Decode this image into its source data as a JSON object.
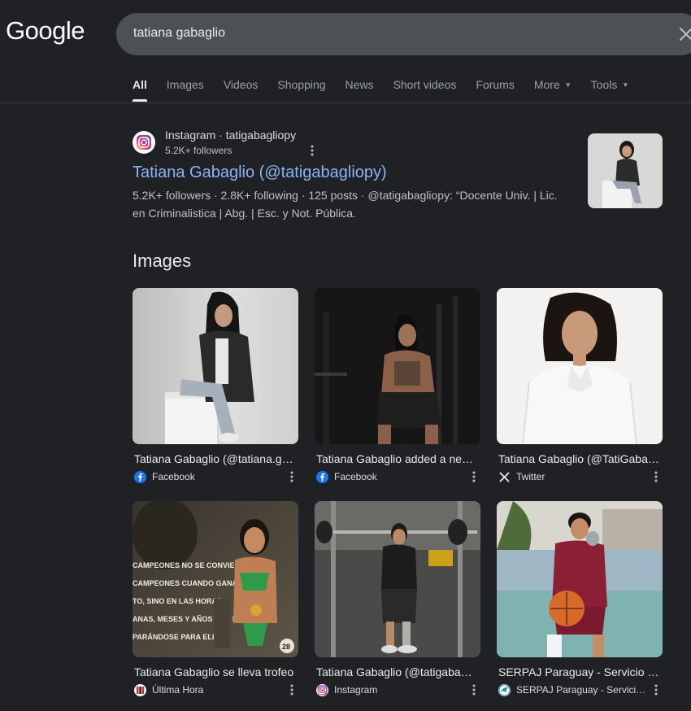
{
  "header": {
    "logo_text": "Google",
    "search_query": "tatiana gabaglio"
  },
  "tabs": [
    {
      "label": "All",
      "active": true
    },
    {
      "label": "Images"
    },
    {
      "label": "Videos"
    },
    {
      "label": "Shopping"
    },
    {
      "label": "News"
    },
    {
      "label": "Short videos"
    },
    {
      "label": "Forums"
    },
    {
      "label": "More",
      "dropdown": true
    },
    {
      "label": "Tools",
      "dropdown": true
    }
  ],
  "result": {
    "source_name": "Instagram · tatigabagliopy",
    "source_sub": "5.2K+ followers",
    "title": "Tatiana Gabaglio (@tatigabagliopy)",
    "snippet": "5.2K+ followers · 2.8K+ following · 125 posts · @tatigabagliopy: “Docente Univ. | Lic. en Criminalistica | Abg. | Esc. y Not. Pública."
  },
  "images_section": {
    "heading": "Images",
    "cards": [
      {
        "caption": "Tatiana Gabaglio (@tatiana.gabaglio)",
        "source": "Facebook",
        "source_icon": "facebook-icon"
      },
      {
        "caption": "Tatiana Gabaglio added a new photo",
        "source": "Facebook",
        "source_icon": "facebook-icon"
      },
      {
        "caption": "Tatiana Gabaglio (@TatiGabaglio)",
        "source": "Twitter",
        "source_icon": "x-icon"
      },
      {
        "caption": "Tatiana Gabaglio se lleva trofeo",
        "source": "Última Hora",
        "source_icon": "ultima-hora-icon"
      },
      {
        "caption": "Tatiana Gabaglio (@tatigabagliopy)",
        "source": "Instagram",
        "source_icon": "instagram-icon"
      },
      {
        "caption": "SERPAJ Paraguay - Servicio Paz y Justicia",
        "source": "SERPAJ Paraguay - Servicio Paz y Justicia",
        "source_icon": "serpaj-icon"
      }
    ]
  },
  "image_text": {
    "poster_lines": [
      "CAMPEONES NO SE CONVIERTEN",
      "CAMPEONES CUANDO GANAN UN",
      "TO, SINO EN LAS HORAS,",
      "ANAS, MESES Y AÑOS QUE PASAN",
      "PARÁNDOSE PARA ELLO.\""
    ],
    "medal_number": "28"
  },
  "colors": {
    "background": "#202124",
    "link": "#8ab4f8",
    "search_box": "#4d5156",
    "facebook": "#1877f2"
  }
}
